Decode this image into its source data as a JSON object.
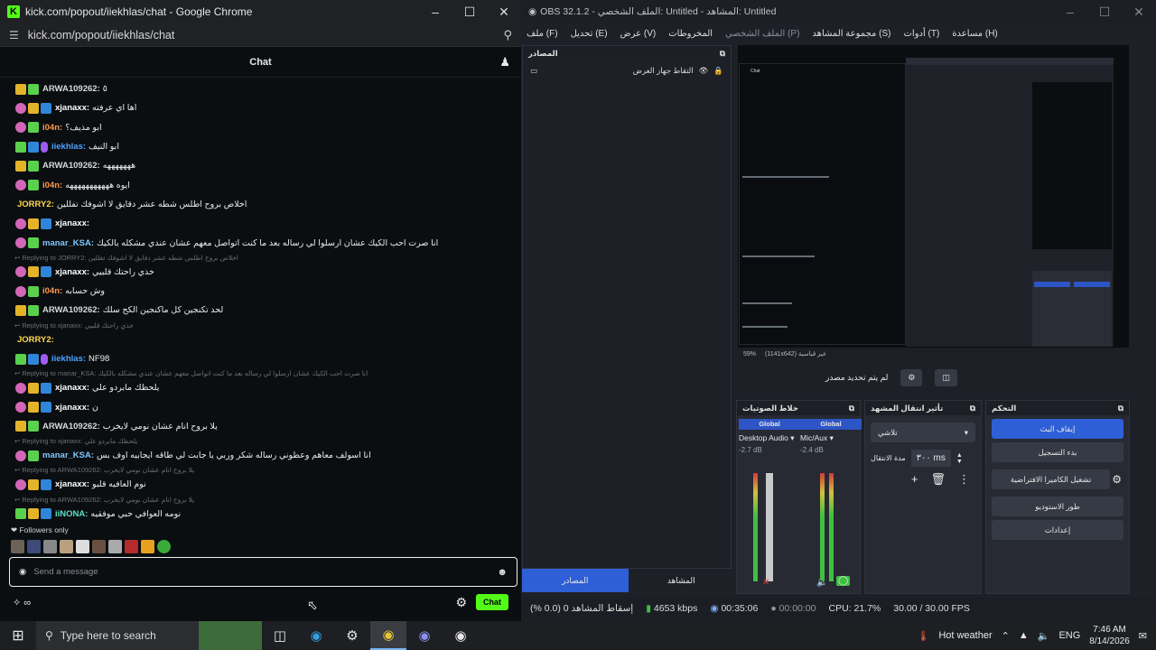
{
  "browser": {
    "tab_title": "kick.com/popout/iiekhlas/chat - Google Chrome",
    "url": "kick.com/popout/iiekhlas/chat"
  },
  "chat": {
    "header": "Chat",
    "followers_only": "Followers only",
    "input_placeholder": "Send a message",
    "send_label": "Chat",
    "messages": [
      {
        "type": "msg",
        "badges": [
          "crown",
          "green"
        ],
        "user": "ARWA109262:",
        "color": "#d8d8d8",
        "text": "٥"
      },
      {
        "type": "msg",
        "badges": [
          "pink",
          "crown",
          "blue"
        ],
        "user": "xjanaxx:",
        "color": "#ffffff",
        "text": "اها اي عرفته"
      },
      {
        "type": "msg",
        "badges": [
          "pink",
          "green"
        ],
        "user": "i04n:",
        "color": "#ff9a4d",
        "text": "ابو مذيف؟"
      },
      {
        "type": "msg",
        "badges": [
          "green",
          "blue",
          "mic"
        ],
        "user": "iiekhlas:",
        "color": "#4aa3ff",
        "text": "ابو النيف"
      },
      {
        "type": "msg",
        "badges": [
          "crown",
          "green"
        ],
        "user": "ARWA109262:",
        "color": "#d8d8d8",
        "text": "هههههههه"
      },
      {
        "type": "msg",
        "badges": [
          "pink",
          "green"
        ],
        "user": "i04n:",
        "color": "#ff9a4d",
        "text": "ايوه هههههههههههه"
      },
      {
        "type": "msg",
        "badges": [],
        "user": "JORRY2:",
        "color": "#ffd84a",
        "text": "اخلاص بروح اطلس شطه عشر دقايق لا اشوفك تفللين"
      },
      {
        "type": "msg",
        "badges": [
          "pink",
          "crown",
          "blue"
        ],
        "user": "xjanaxx:",
        "color": "#ffffff",
        "text": ""
      },
      {
        "type": "msg",
        "badges": [
          "pink",
          "green"
        ],
        "user": "manar_KSA:",
        "color": "#7ec8ff",
        "text": "انا صرت احب الكيك عشان ارسلوا لي رساله بعد ما كنت اتواصل معهم عشان عندي مشكله بالكيك"
      },
      {
        "type": "reply",
        "text": "Replying to JORRY2: اخلاص بروح اطلس شطه عشر دقايق لا اشوفك تفللين"
      },
      {
        "type": "msg",
        "badges": [
          "pink",
          "crown",
          "blue"
        ],
        "user": "xjanaxx:",
        "color": "#ffffff",
        "text": "خذي راحتك قلبيي"
      },
      {
        "type": "msg",
        "badges": [
          "pink",
          "green"
        ],
        "user": "i04n:",
        "color": "#ff9a4d",
        "text": "وش حسابه"
      },
      {
        "type": "msg",
        "badges": [
          "crown",
          "green"
        ],
        "user": "ARWA109262:",
        "color": "#d8d8d8",
        "text": "لحد تكنجين كل ماكنجين الكح سلك"
      },
      {
        "type": "reply",
        "text": "Replying to xjanaxx: خذي راحتك قلبيي"
      },
      {
        "type": "msg",
        "badges": [],
        "user": "JORRY2:",
        "color": "#ffd84a",
        "text": ""
      },
      {
        "type": "msg",
        "badges": [
          "green",
          "blue",
          "mic"
        ],
        "user": "iiekhlas:",
        "color": "#4aa3ff",
        "text": "NF98"
      },
      {
        "type": "reply",
        "text": "Replying to manar_KSA: انا صرت احب الكيك عشان ارسلوا لي رساله بعد ما كنت اتواصل معهم عشان عندي مشكله بالكيك"
      },
      {
        "type": "msg",
        "badges": [
          "pink",
          "crown",
          "blue"
        ],
        "user": "xjanaxx:",
        "color": "#ffffff",
        "text": "يلحظك مابردو علي"
      },
      {
        "type": "msg",
        "badges": [
          "pink",
          "crown",
          "blue"
        ],
        "user": "xjanaxx:",
        "color": "#ffffff",
        "text": "ن"
      },
      {
        "type": "msg",
        "badges": [
          "crown",
          "green"
        ],
        "user": "ARWA109262:",
        "color": "#d8d8d8",
        "text": "يلا بروح انام عشان نومي لايخرب"
      },
      {
        "type": "reply",
        "text": "Replying to xjanaxx: يلحظك مابردو علي"
      },
      {
        "type": "msg",
        "badges": [
          "pink",
          "green"
        ],
        "user": "manar_KSA:",
        "color": "#7ec8ff",
        "text": "انا اسولف معاهم وعطوني رساله شكر وربي يا جابت لي طاقه ايجابيه اوف بس"
      },
      {
        "type": "reply",
        "text": "Replying to ARWA109262: يلا بروح انام عشان نومي لايخرب"
      },
      {
        "type": "msg",
        "badges": [
          "pink",
          "crown",
          "blue"
        ],
        "user": "xjanaxx:",
        "color": "#ffffff",
        "text": "نوم العافيه قلبو"
      },
      {
        "type": "reply",
        "text": "Replying to ARWA109262: يلا بروح انام عشان نومي لايخرب"
      },
      {
        "type": "msg",
        "badges": [
          "green",
          "crown",
          "blue"
        ],
        "user": "iiNONA:",
        "color": "#5ce0c6",
        "text": "نومه العوافي حبي موفقيه"
      }
    ]
  },
  "obs": {
    "title": "OBS 32.1.2 - الملف الشخصي: Untitled - المشاهد: Untitled",
    "menu": [
      "ملف (F)",
      "تحديل (E)",
      "عرض (V)",
      "المخروطات",
      "الملف الشخصي (P)",
      "مجموعة المشاهد (S)",
      "أدوات (T)",
      "مساعدة (H)"
    ],
    "sources_title": "المصادر",
    "source_item": "التقاط جهاز العرض",
    "preview_zoom": "59%",
    "preview_size": "(1141x642) غير قياسية",
    "no_source": "لم يتم تحديد مصدر",
    "mixer_title": "خلاط الصوتيات",
    "mixer": [
      {
        "label": "Global",
        "name": "Desktop Audio",
        "db": "-2.7 dB"
      },
      {
        "label": "Global",
        "name": "Mic/Aux",
        "db": "-2.4 dB"
      }
    ],
    "meter_ticks": [
      "0",
      "-6",
      "-12",
      "-18",
      "-24",
      "-30",
      "-36",
      "-42",
      "-48",
      "-54",
      "-60"
    ],
    "transition_title": "تأثير انتقال المشهد",
    "transition_type": "تلاشي",
    "duration_label": "مدة الانتقال",
    "duration_value": "٣٠٠ ms",
    "controls_title": "التحكم",
    "controls": [
      "إيقاف البث",
      "بدء التسجيل",
      "تشغيل الكاميرا الافتراضية",
      "طور الاستوديو",
      "إعدادات"
    ],
    "dock_tabs": [
      "المصادر",
      "المشاهد"
    ],
    "status": {
      "dropped": "إسقاط المشاهد 0 (0.0 %)",
      "bitrate": "4653 kbps",
      "live_time": "00:35:06",
      "rec_time": "00:00:00",
      "cpu": "CPU: 21.7%",
      "fps": "30.00 / 30.00 FPS"
    }
  },
  "taskbar": {
    "search": "Type here to search",
    "weather": "Hot weather",
    "lang": "ENG",
    "time": "7:46 AM",
    "date": "8/14/2026"
  }
}
